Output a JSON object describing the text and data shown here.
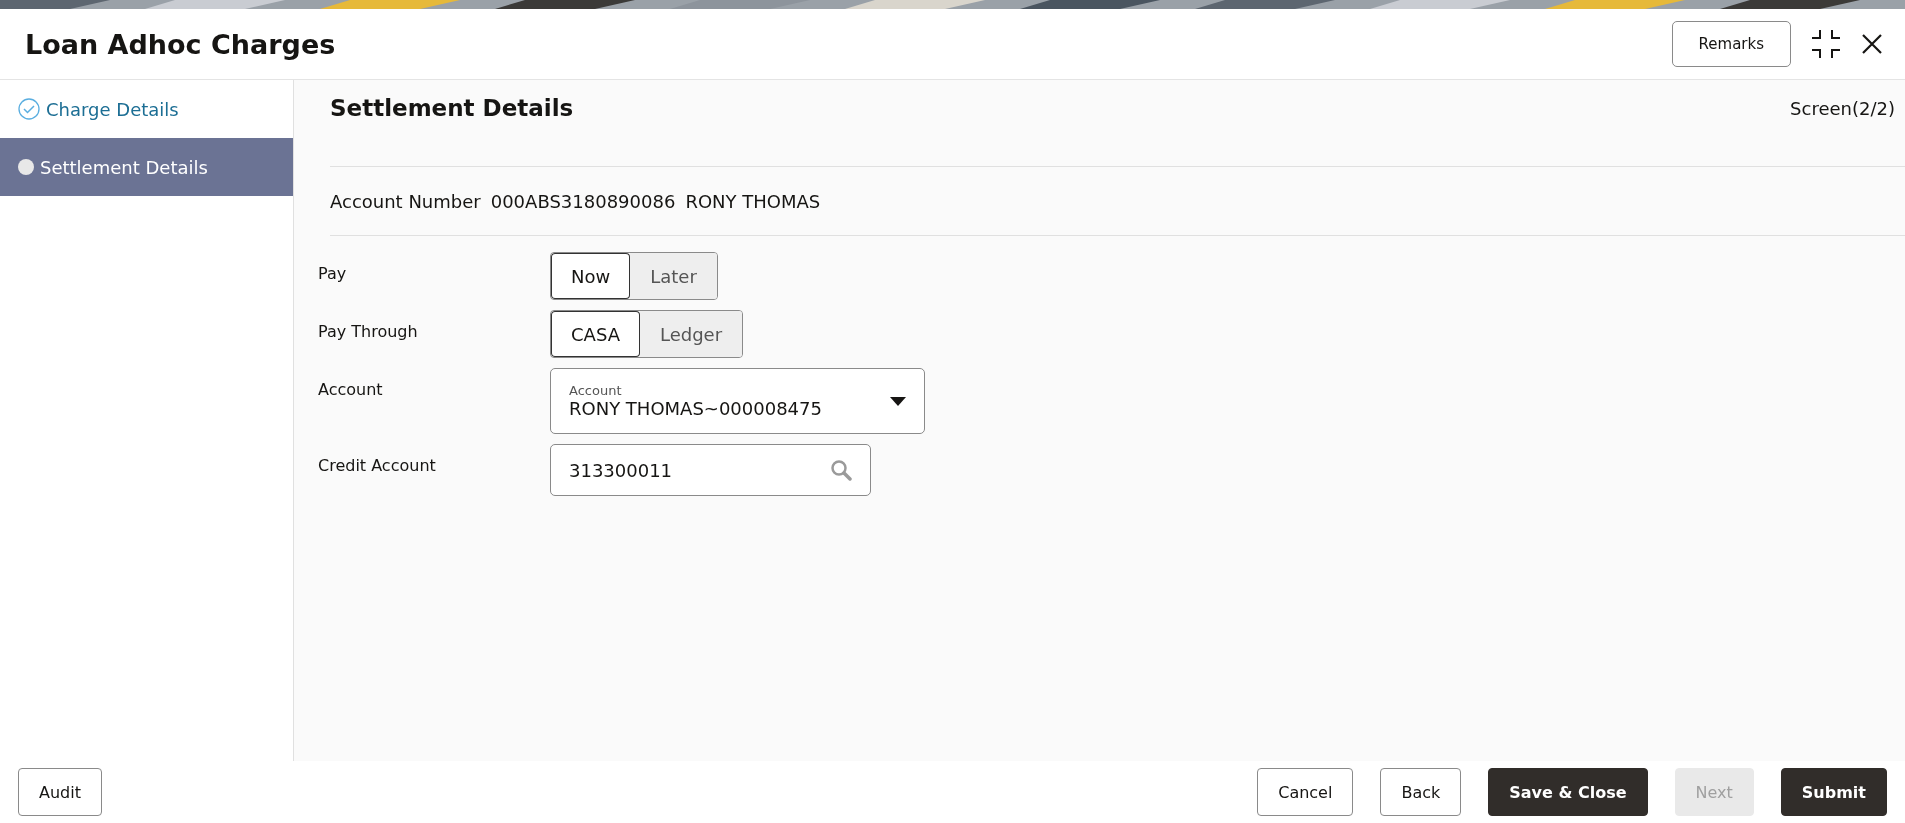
{
  "window": {
    "title": "Loan Adhoc Charges"
  },
  "header_buttons": [
    {
      "label": "Remarks"
    }
  ],
  "steps": [
    {
      "label": "Charge Details",
      "completed": true,
      "selected": false
    },
    {
      "label": "Settlement Details",
      "completed": false,
      "selected": true
    }
  ],
  "section": {
    "title": "Settlement Details",
    "screen": "Screen(2/2)"
  },
  "account_info": {
    "label": "Account Number",
    "number": "000ABS3180890086",
    "name": "RONY THOMAS"
  },
  "form": [
    {
      "kind": "toggle",
      "label": "Pay",
      "options": [
        {
          "label": "Now",
          "selected": true
        },
        {
          "label": "Later",
          "selected": false
        }
      ]
    },
    {
      "kind": "toggle",
      "label": "Pay Through",
      "options": [
        {
          "label": "CASA",
          "selected": true
        },
        {
          "label": "Ledger",
          "selected": false
        }
      ]
    },
    {
      "kind": "select",
      "label": "Account",
      "floating_label": "Account",
      "value": "RONY THOMAS~000008475"
    },
    {
      "kind": "search",
      "label": "Credit Account",
      "value": "313300011"
    }
  ],
  "footer_left": [
    {
      "label": "Audit",
      "kind": "outline",
      "disabled": false
    }
  ],
  "footer_right": [
    {
      "label": "Cancel",
      "kind": "outline",
      "disabled": false
    },
    {
      "label": "Back",
      "kind": "outline",
      "disabled": false
    },
    {
      "label": "Save & Close",
      "kind": "primary",
      "disabled": false
    },
    {
      "label": "Next",
      "kind": "primary",
      "disabled": true
    },
    {
      "label": "Submit",
      "kind": "primary",
      "disabled": false
    }
  ]
}
